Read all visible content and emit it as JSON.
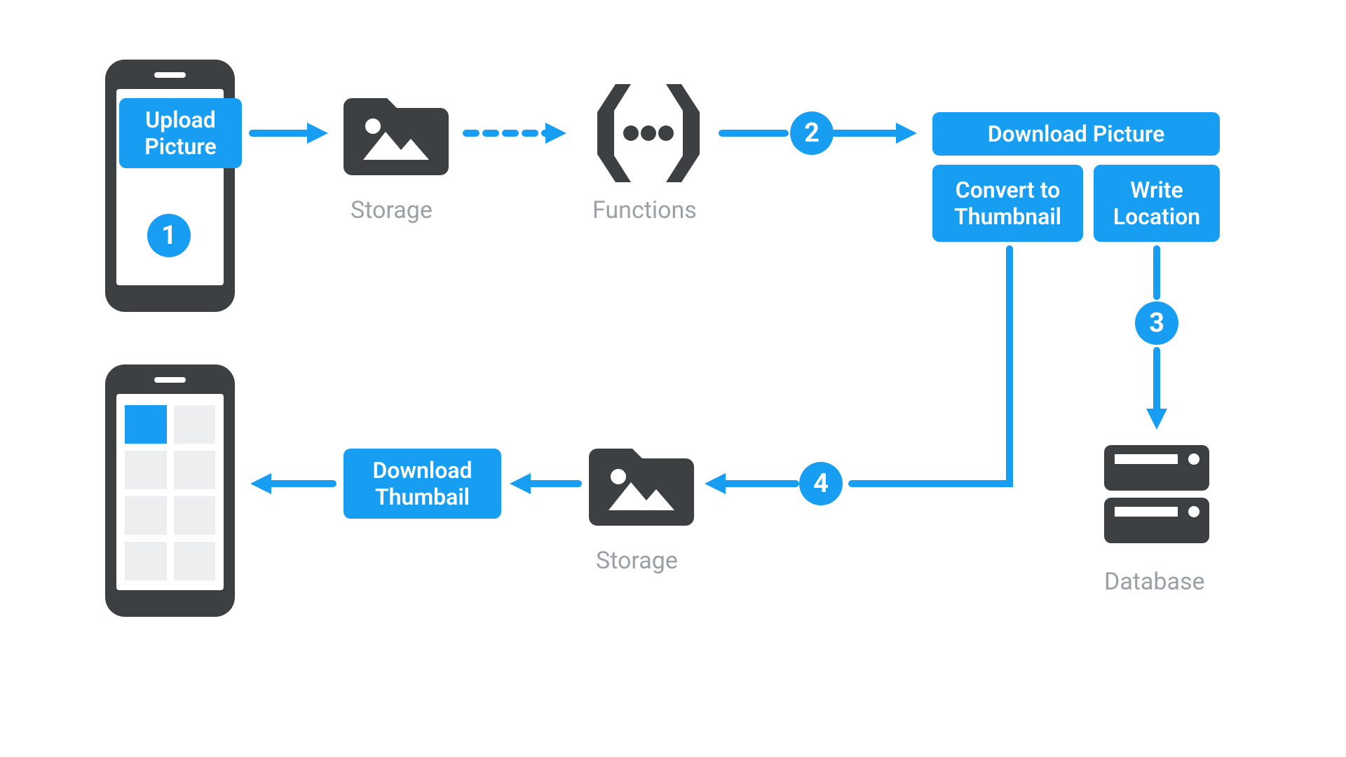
{
  "colors": {
    "accent": "#179ef2",
    "iconDark": "#3c4043",
    "muted": "#9aa0a6",
    "light": "#eceef0"
  },
  "actions": {
    "upload": "Upload\nPicture",
    "download_picture": "Download Picture",
    "convert": "Convert to\nThumbnail",
    "write_location": "Write\nLocation",
    "download_thumb": "Download\nThumbail"
  },
  "steps": {
    "s1": "1",
    "s2": "2",
    "s3": "3",
    "s4": "4"
  },
  "labels": {
    "storage_top": "Storage",
    "functions": "Functions",
    "storage_bottom": "Storage",
    "database": "Database"
  },
  "icons": {
    "phone_upload": "phone-icon",
    "phone_download": "phone-gallery-icon",
    "storage": "folder-image-icon",
    "functions": "cloud-functions-icon",
    "database": "database-icon"
  }
}
